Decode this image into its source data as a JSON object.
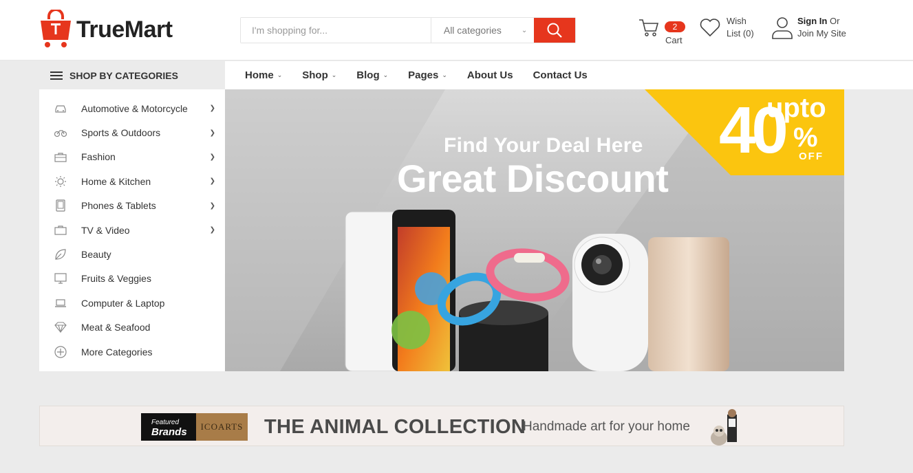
{
  "brand": {
    "name": "TrueMart",
    "accent": "#e6361d"
  },
  "search": {
    "placeholder": "I'm shopping for...",
    "category": "All categories",
    "button_icon": "search-icon"
  },
  "cart": {
    "count": "2",
    "label": "Cart"
  },
  "wishlist": {
    "line1": "Wish",
    "line2": "List (0)"
  },
  "account": {
    "signin": "Sign In",
    "or": "Or",
    "join": "Join My Site"
  },
  "categories": {
    "title": "SHOP BY CATEGORIES",
    "items": [
      {
        "label": "Automotive & Motorcycle",
        "icon": "car-icon",
        "arrow": true
      },
      {
        "label": "Sports & Outdoors",
        "icon": "bicycle-icon",
        "arrow": true
      },
      {
        "label": "Fashion",
        "icon": "briefcase-icon",
        "arrow": true
      },
      {
        "label": "Home & Kitchen",
        "icon": "sun-icon",
        "arrow": true
      },
      {
        "label": "Phones & Tablets",
        "icon": "tablet-icon",
        "arrow": true
      },
      {
        "label": "TV & Video",
        "icon": "tv-case-icon",
        "arrow": true
      },
      {
        "label": "Beauty",
        "icon": "leaf-icon",
        "arrow": false
      },
      {
        "label": "Fruits & Veggies",
        "icon": "monitor-icon",
        "arrow": false
      },
      {
        "label": "Computer & Laptop",
        "icon": "laptop-icon",
        "arrow": false
      },
      {
        "label": "Meat & Seafood",
        "icon": "diamond-icon",
        "arrow": false
      },
      {
        "label": "More Categories",
        "icon": "plus-circle-icon",
        "arrow": false
      }
    ]
  },
  "nav": [
    {
      "label": "Home",
      "dropdown": true,
      "active": true
    },
    {
      "label": "Shop",
      "dropdown": true,
      "active": false
    },
    {
      "label": "Blog",
      "dropdown": true,
      "active": false
    },
    {
      "label": "Pages",
      "dropdown": true,
      "active": false
    },
    {
      "label": "About Us",
      "dropdown": false,
      "active": false
    },
    {
      "label": "Contact Us",
      "dropdown": false,
      "active": false
    }
  ],
  "banner": {
    "subtitle": "Find Your Deal Here",
    "title": "Great Discount",
    "discount_upto": "upto",
    "discount_value": "40",
    "discount_pct": "%",
    "discount_off": "OFF",
    "badge_color": "#fbc50f"
  },
  "brand_strip": {
    "tag_line1": "Featured",
    "tag_line2": "Brands",
    "logo": "ICOARTS",
    "title": "THE ANIMAL COLLECTION",
    "subtitle": "Handmade art for your home"
  }
}
